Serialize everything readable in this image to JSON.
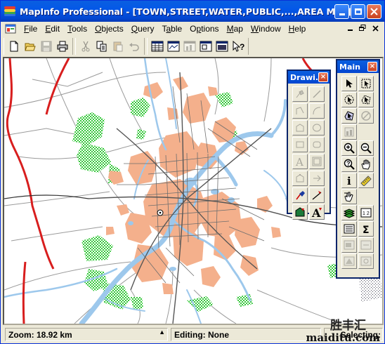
{
  "window": {
    "title": "MapInfo Professional - [TOWN,STREET,WATER,PUBLIC,...,AREA Map]",
    "title_buttons": [
      "minimize",
      "maximize",
      "close"
    ]
  },
  "menu": {
    "items": [
      "File",
      "Edit",
      "Tools",
      "Objects",
      "Query",
      "Table",
      "Options",
      "Map",
      "Window",
      "Help"
    ],
    "underline": [
      "F",
      "E",
      "T",
      "O",
      "Q",
      "a",
      "p",
      "M",
      "W",
      "H"
    ],
    "mdi_buttons": [
      "-",
      "▫",
      "×"
    ]
  },
  "toolbar": {
    "groups": [
      [
        "new-icon",
        "open-icon",
        "save-icon",
        "print-icon"
      ],
      [
        "cut-icon",
        "copy-icon",
        "paste-icon",
        "undo-icon"
      ],
      [
        "new-browser-icon",
        "new-mapper-icon",
        "new-grapher-icon",
        "new-layout-icon",
        "new-redistrict-icon",
        "help-pointer-icon"
      ]
    ]
  },
  "drawing_palette": {
    "title": "Drawi...",
    "close": "×",
    "tools": [
      "symbol",
      "line",
      "polyline",
      "arc",
      "polygon",
      "ellipse",
      "rectangle",
      "rounded-rectangle",
      "text",
      "frame",
      "reshape",
      "add-node",
      "symbol-style",
      "line-style",
      "region-style",
      "text-style"
    ]
  },
  "main_palette": {
    "title": "Main",
    "close": "×",
    "tools": [
      "select",
      "marquee-select",
      "radius-select",
      "polygon-select",
      "boundary-select",
      "unselect-all",
      "graph-select",
      "zoom-in",
      "zoom-out",
      "grabber",
      "info",
      "ruler",
      "hotlink",
      "layer-control",
      "show-legend",
      "browser",
      "statistics",
      "label",
      "drag-window",
      "clip-region",
      "set-target"
    ]
  },
  "status": {
    "zoom": "Zoom: 18.92 km",
    "editing": "Editing: None",
    "selecting": "Selecting:"
  },
  "watermark": {
    "chinese": "胜丰汇",
    "url": "maiditu.com"
  },
  "colors": {
    "title_blue": "#0458e8",
    "road_red": "#d81e1e",
    "water_blue": "#9dc8ec",
    "town_salmon": "#f4b08c",
    "park_green": "#37c83c",
    "street_gray": "#8c8c8c"
  }
}
